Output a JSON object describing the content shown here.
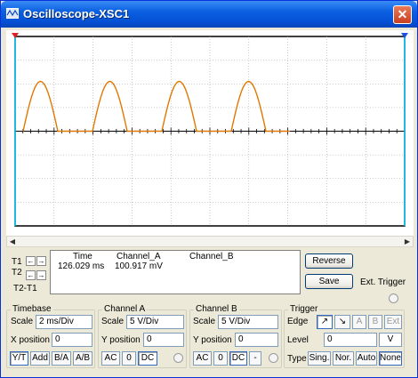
{
  "window": {
    "title": "Oscilloscope-XSC1",
    "close_label": "✕"
  },
  "readout": {
    "headers": {
      "time": "Time",
      "channel_a": "Channel_A",
      "channel_b": "Channel_B"
    },
    "values": {
      "time": "126.029 ms",
      "channel_a": "100.917 mV",
      "channel_b": ""
    }
  },
  "cursors": {
    "t1": "T1",
    "t2": "T2",
    "delta": "T2-T1"
  },
  "buttons": {
    "reverse": "Reverse",
    "save": "Save",
    "ext_trigger": "Ext. Trigger"
  },
  "timebase": {
    "title": "Timebase",
    "scale_label": "Scale",
    "scale_value": "2 ms/Div",
    "xpos_label": "X position",
    "xpos_value": "0",
    "modes": [
      "Y/T",
      "Add",
      "B/A",
      "A/B"
    ]
  },
  "channel_a": {
    "title": "Channel A",
    "scale_label": "Scale",
    "scale_value": "5  V/Div",
    "ypos_label": "Y position",
    "ypos_value": "0",
    "coupling": [
      "AC",
      "0",
      "DC"
    ]
  },
  "channel_b": {
    "title": "Channel B",
    "scale_label": "Scale",
    "scale_value": "5  V/Div",
    "ypos_label": "Y position",
    "ypos_value": "0",
    "coupling": [
      "AC",
      "0",
      "DC",
      "-"
    ]
  },
  "trigger": {
    "title": "Trigger",
    "edge_label": "Edge",
    "edge_buttons": [
      "↗",
      "↘",
      "A",
      "B",
      "Ext"
    ],
    "level_label": "Level",
    "level_value": "0",
    "level_unit": "V",
    "type_label": "Type",
    "types": [
      "Sing.",
      "Nor.",
      "Auto",
      "None"
    ]
  },
  "colors": {
    "trace": "#e07800",
    "grid": "#a0a0a0",
    "cursor1": "#00ccff",
    "cursor2": "#00ccff",
    "accent": "#0550d4"
  },
  "icons": {
    "title": "oscilloscope-icon",
    "close": "close-icon"
  },
  "waveform": {
    "type": "half-wave rectified sine",
    "cycles_visible": 4,
    "peak_div": 2.1
  }
}
